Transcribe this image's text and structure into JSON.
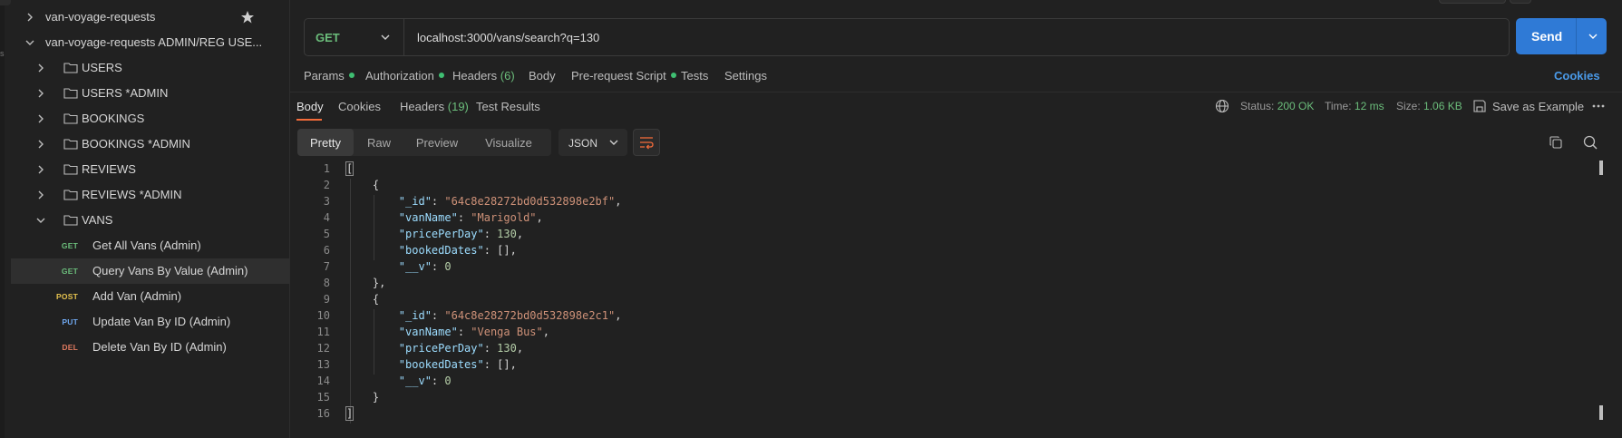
{
  "sidebar": {
    "collections": [
      {
        "label": "van-voyage-requests",
        "expanded": false,
        "starred": true
      },
      {
        "label": "van-voyage-requests ADMIN/REG USE...",
        "expanded": true
      }
    ],
    "folders": [
      {
        "label": "USERS",
        "expanded": false
      },
      {
        "label": "USERS *ADMIN",
        "expanded": false
      },
      {
        "label": "BOOKINGS",
        "expanded": false
      },
      {
        "label": "BOOKINGS *ADMIN",
        "expanded": false
      },
      {
        "label": "REVIEWS",
        "expanded": false
      },
      {
        "label": "REVIEWS *ADMIN",
        "expanded": false
      },
      {
        "label": "VANS",
        "expanded": true
      }
    ],
    "requests": [
      {
        "method": "GET",
        "label": "Get All Vans (Admin)"
      },
      {
        "method": "GET",
        "label": "Query Vans By Value (Admin)",
        "selected": true
      },
      {
        "method": "POST",
        "label": "Add Van (Admin)"
      },
      {
        "method": "PUT",
        "label": "Update Van By ID (Admin)"
      },
      {
        "method": "DEL",
        "label": "Delete Van By ID (Admin)"
      }
    ]
  },
  "request": {
    "method": "GET",
    "url": "localhost:3000/vans/search?q=130",
    "send_label": "Send",
    "tabs": {
      "params": "Params",
      "authorization": "Authorization",
      "headers": "Headers",
      "headers_count": "(6)",
      "body": "Body",
      "prerequest": "Pre-request Script",
      "tests": "Tests",
      "settings": "Settings"
    },
    "cookies_link": "Cookies"
  },
  "response": {
    "tabs": {
      "body": "Body",
      "cookies": "Cookies",
      "headers": "Headers",
      "headers_count": "(19)",
      "test_results": "Test Results"
    },
    "status_label": "Status:",
    "status_value": "200 OK",
    "time_label": "Time:",
    "time_value": "12 ms",
    "size_label": "Size:",
    "size_value": "1.06 KB",
    "save_example": "Save as Example",
    "views": [
      "Pretty",
      "Raw",
      "Preview",
      "Visualize"
    ],
    "format": "JSON",
    "line_numbers": [
      "1",
      "2",
      "3",
      "4",
      "5",
      "6",
      "7",
      "8",
      "9",
      "10",
      "11",
      "12",
      "13",
      "14",
      "15",
      "16"
    ],
    "items": [
      {
        "_id": "\"64c8e28272bd0d532898e2bf\"",
        "vanName": "\"Marigold\"",
        "pricePerDay": "130",
        "bookedDates": "[]",
        "__v": "0"
      },
      {
        "_id": "\"64c8e28272bd0d532898e2c1\"",
        "vanName": "\"Venga Bus\"",
        "pricePerDay": "130",
        "bookedDates": "[]",
        "__v": "0"
      }
    ],
    "keys": {
      "id": "\"_id\"",
      "vanName": "\"vanName\"",
      "pricePerDay": "\"pricePerDay\"",
      "bookedDates": "\"bookedDates\"",
      "v": "\"__v\""
    }
  },
  "colors": {
    "accent_send": "#2f7ad6",
    "method_get": "#6bbd7b",
    "status_ok": "#6bbd7b",
    "active_tab_underline": "#f26b3a"
  }
}
